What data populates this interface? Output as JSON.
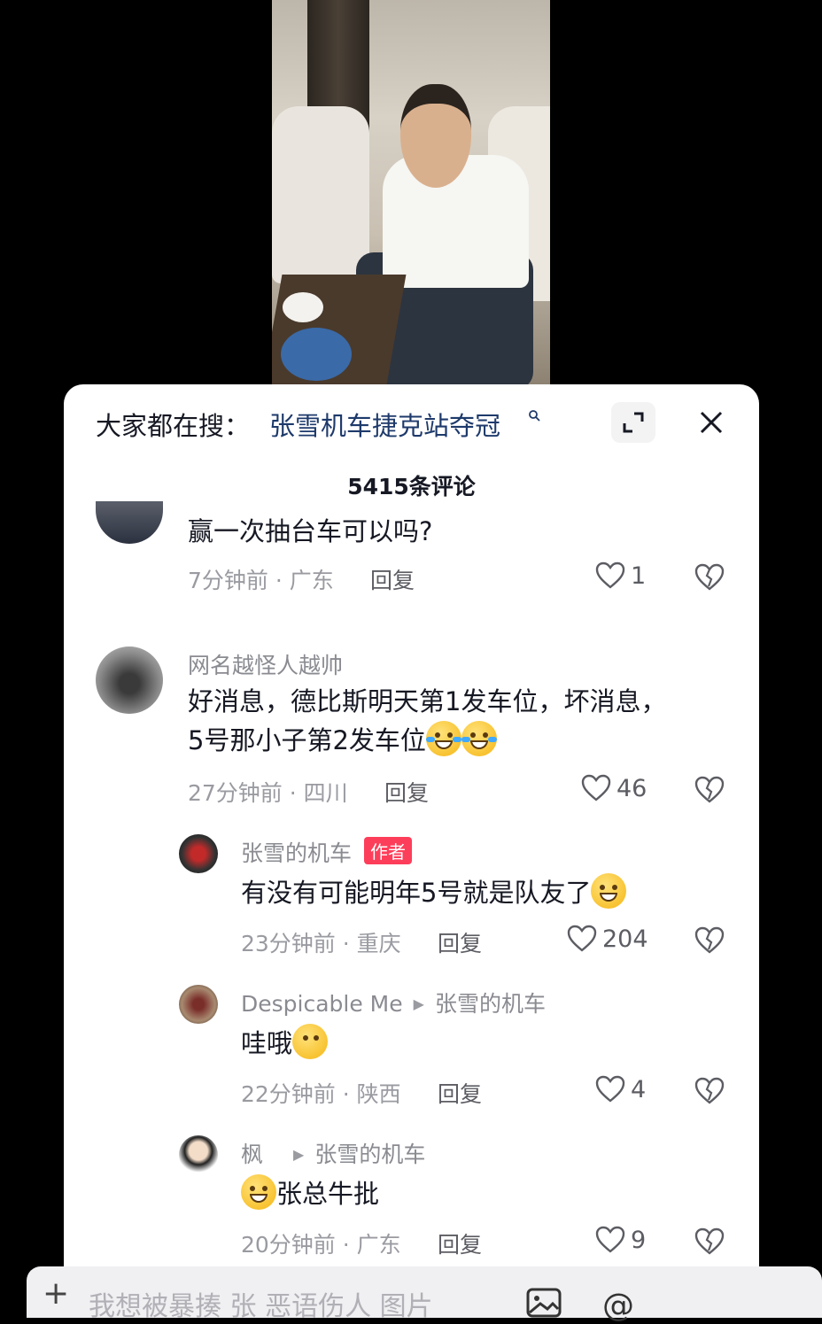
{
  "search": {
    "prefix": "大家都在搜：",
    "term": "张雪机车捷克站夺冠"
  },
  "comment_count": "5415条评论",
  "comments": [
    {
      "text": "赢一次抽台车可以吗?",
      "time_location": "7分钟前 · 广东",
      "reply_label": "回复",
      "likes": "1"
    },
    {
      "name": "网名越怪人越帅",
      "text_line1": "好消息，德比斯明天第1发车位，坏消息，",
      "text_line2": "5号那小子第2发车位",
      "time_location": "27分钟前 · 四川",
      "reply_label": "回复",
      "likes": "46"
    },
    {
      "name": "张雪的机车",
      "badge": "作者",
      "text": "有没有可能明年5号就是队友了",
      "time_location": "23分钟前 · 重庆",
      "reply_label": "回复",
      "likes": "204"
    },
    {
      "name": "Despicable Me",
      "reply_to": "张雪的机车",
      "text": "哇哦",
      "time_location": "22分钟前 · 陕西",
      "reply_label": "回复",
      "likes": "4"
    },
    {
      "name": "枫",
      "reply_to": "张雪的机车",
      "text": "张总牛批",
      "time_location": "20分钟前 · 广东",
      "reply_label": "回复",
      "likes": "9"
    }
  ],
  "input": {
    "placeholder": "我想被暴揍 张 恶语伤人 图片"
  },
  "icons": {
    "search": "search-icon",
    "expand": "expand-icon",
    "close": "close-icon",
    "like": "heart-icon",
    "dislike": "broken-heart-icon",
    "image": "image-icon",
    "at": "at-icon"
  }
}
